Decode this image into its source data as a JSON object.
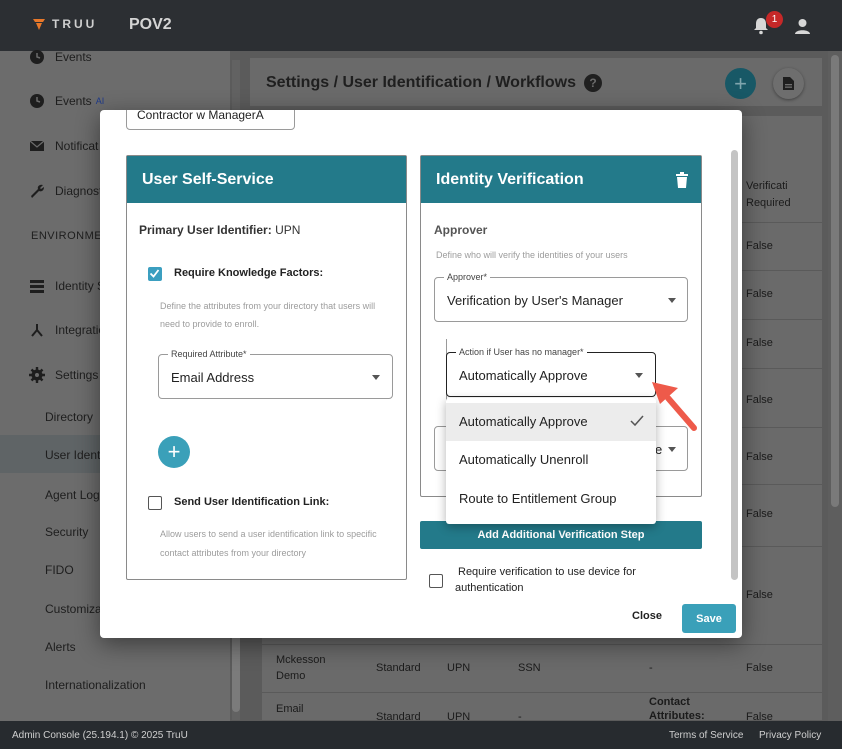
{
  "app": {
    "logo_text": "TRUU",
    "org": "POV2",
    "notification_count": "1"
  },
  "sidebar": {
    "items": [
      {
        "label": "Events",
        "icon": "clock-icon"
      },
      {
        "label": "Events",
        "badge": "AI",
        "icon": "clock-icon"
      },
      {
        "label": "Notificat",
        "icon": "mail-icon"
      },
      {
        "label": "Diagnost",
        "icon": "wrench-icon"
      }
    ],
    "section_label": "ENVIRONMEN",
    "env_items": [
      {
        "label": "Identity S",
        "icon": "list-icon"
      },
      {
        "label": "Integratio",
        "icon": "integration-icon"
      },
      {
        "label": "Settings",
        "icon": "gear-icon"
      }
    ],
    "settings_sub": [
      "Directory",
      "User Ident",
      "Agent Log",
      "Security",
      "FIDO",
      "Customiza",
      "Alerts",
      "Internationalization"
    ]
  },
  "main": {
    "title": "Settings / User Identification / Workflows",
    "help": "?",
    "table": {
      "header_col": "Verificati",
      "header_col2": "Required",
      "rows_value": [
        "False",
        "False",
        "False",
        "False",
        "False",
        "False",
        "False"
      ],
      "row_mckesson": {
        "name1": "Mckesson",
        "name2": "Demo",
        "type": "Standard",
        "id": "UPN",
        "attr": "SSN",
        "dash": "-",
        "value": "False"
      },
      "row_email": {
        "name": "Email",
        "type": "Standard",
        "id": "UPN",
        "attr": "-",
        "contact1": "Contact",
        "contact2": "Attributes:",
        "value": "False"
      }
    }
  },
  "modal": {
    "top_input_value": "Contractor w ManagerA",
    "self_service": {
      "title": "User Self-Service",
      "primary_label": "Primary User Identifier:",
      "primary_value": "UPN",
      "knowledge_label": "Require Knowledge Factors:",
      "knowledge_checked": true,
      "knowledge_hint1": "Define the attributes from your directory that users will",
      "knowledge_hint2": "need to provide to enroll.",
      "required_attr_legend": "Required Attribute*",
      "required_attr_value": "Email Address",
      "add_label": "+",
      "send_link_label": "Send User Identification Link:",
      "send_link_checked": false,
      "send_link_hint1": "Allow users to send a user identification link to specific",
      "send_link_hint2": "contact attributes from your directory"
    },
    "identity_verification": {
      "title": "Identity Verification",
      "approver_heading": "Approver",
      "approver_hint": "Define who will verify the identities of your users",
      "approver_legend": "Approver*",
      "approver_value": "Verification by User's Manager",
      "no_manager_legend": "Action if User has no manager*",
      "no_manager_value": "Automatically Approve",
      "hidden_select_tail": "e"
    },
    "add_step_label": "Add Additional Verification Step",
    "require_device_label1": "Require verification to use device for",
    "require_device_label2": "authentication",
    "close_label": "Close",
    "save_label": "Save"
  },
  "dropdown": {
    "options": [
      "Automatically Approve",
      "Automatically Unenroll",
      "Route to Entitlement Group"
    ],
    "selected_index": 0
  },
  "footer": {
    "left": "Admin Console (25.194.1) © 2025 TruU",
    "terms": "Terms of Service",
    "privacy": "Privacy Policy"
  },
  "colors": {
    "teal": "#237a8a",
    "accent": "#3aa0b9",
    "badge": "#c62828",
    "arrow": "#ee5a4a"
  }
}
